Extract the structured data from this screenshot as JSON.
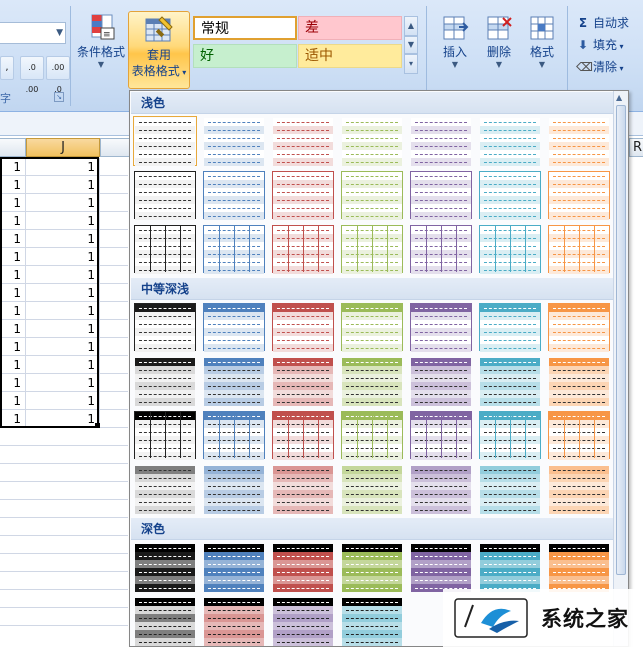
{
  "ribbon": {
    "number_format_value": "",
    "comma_label": ",",
    "inc_decimal_label": ".0 .00",
    "dec_decimal_label": ".00 .0",
    "number_group_label": "字",
    "conditional_format": "条件格式",
    "table_format_line1": "套用",
    "table_format_line2": "表格格式",
    "cell_styles": [
      {
        "label": "常规",
        "bg": "#ffffff",
        "fg": "#000000",
        "border": "#e0a030"
      },
      {
        "label": "差",
        "bg": "#ffc7ce",
        "fg": "#9c0006",
        "border": "#f0b0b8"
      },
      {
        "label": "好",
        "bg": "#c6efce",
        "fg": "#006100",
        "border": "#b3dfbc"
      },
      {
        "label": "适中",
        "bg": "#ffeb9c",
        "fg": "#9c5700",
        "border": "#ecd98a"
      }
    ],
    "insert": "插入",
    "delete": "删除",
    "format": "格式",
    "autosum": "自动求",
    "fill": "填充",
    "clear": "清除"
  },
  "sheet": {
    "col_J": "J",
    "col_R": "R",
    "cell_value": "1",
    "row_count": 15
  },
  "gallery": {
    "sections": {
      "light": "浅色",
      "medium": "中等深浅",
      "dark": "深色"
    },
    "palette": [
      {
        "name": "none",
        "dark": "#1a1a1a",
        "mid": "#7f7f7f",
        "light": "#d9d9d9",
        "pale": "#f2f2f2"
      },
      {
        "name": "blue",
        "dark": "#4f81bd",
        "mid": "#95b3d7",
        "light": "#b8cce4",
        "pale": "#dce6f1"
      },
      {
        "name": "red",
        "dark": "#c0504d",
        "mid": "#da9694",
        "light": "#e6b8b7",
        "pale": "#f2dcdb"
      },
      {
        "name": "green",
        "dark": "#9bbb59",
        "mid": "#c4d79b",
        "light": "#d8e4bc",
        "pale": "#ebf1de"
      },
      {
        "name": "purple",
        "dark": "#8064a2",
        "mid": "#b1a0c7",
        "light": "#ccc0da",
        "pale": "#e4dfec"
      },
      {
        "name": "aqua",
        "dark": "#4bacc6",
        "mid": "#92cddc",
        "light": "#b7dee8",
        "pale": "#daeef3"
      },
      {
        "name": "orange",
        "dark": "#f79646",
        "mid": "#fabf8f",
        "light": "#fcd5b4",
        "pale": "#fde9d9"
      }
    ]
  },
  "watermark": {
    "text": "系统之家"
  }
}
